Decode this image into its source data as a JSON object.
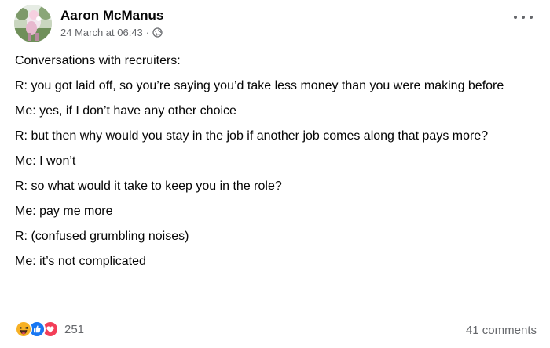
{
  "post": {
    "author": "Aaron McManus",
    "timestamp": "24 March at 06:43",
    "separator": "·",
    "privacy_icon": "globe-icon",
    "more_icon": "more-options-icon",
    "paragraphs": [
      "Conversations with recruiters:",
      "R: you got laid off, so you’re saying you’d take less money than you were making before",
      "Me: yes, if I don’t have any other choice",
      "R: but then why would you stay in the job if another job comes along that pays more?",
      "Me: I won’t",
      "R: so what would it take to keep you in the role?",
      "Me: pay me more",
      "R: (confused grumbling noises)",
      "Me: it’s not complicated"
    ]
  },
  "footer": {
    "reaction_icons": [
      "haha-icon",
      "like-icon",
      "love-icon"
    ],
    "reaction_count": "251",
    "comments": "41 comments"
  },
  "colors": {
    "text": "#050505",
    "secondary": "#65676b",
    "like_blue": "#1877f2",
    "love_red": "#f33e58",
    "haha_yellow": "#f7b125"
  }
}
